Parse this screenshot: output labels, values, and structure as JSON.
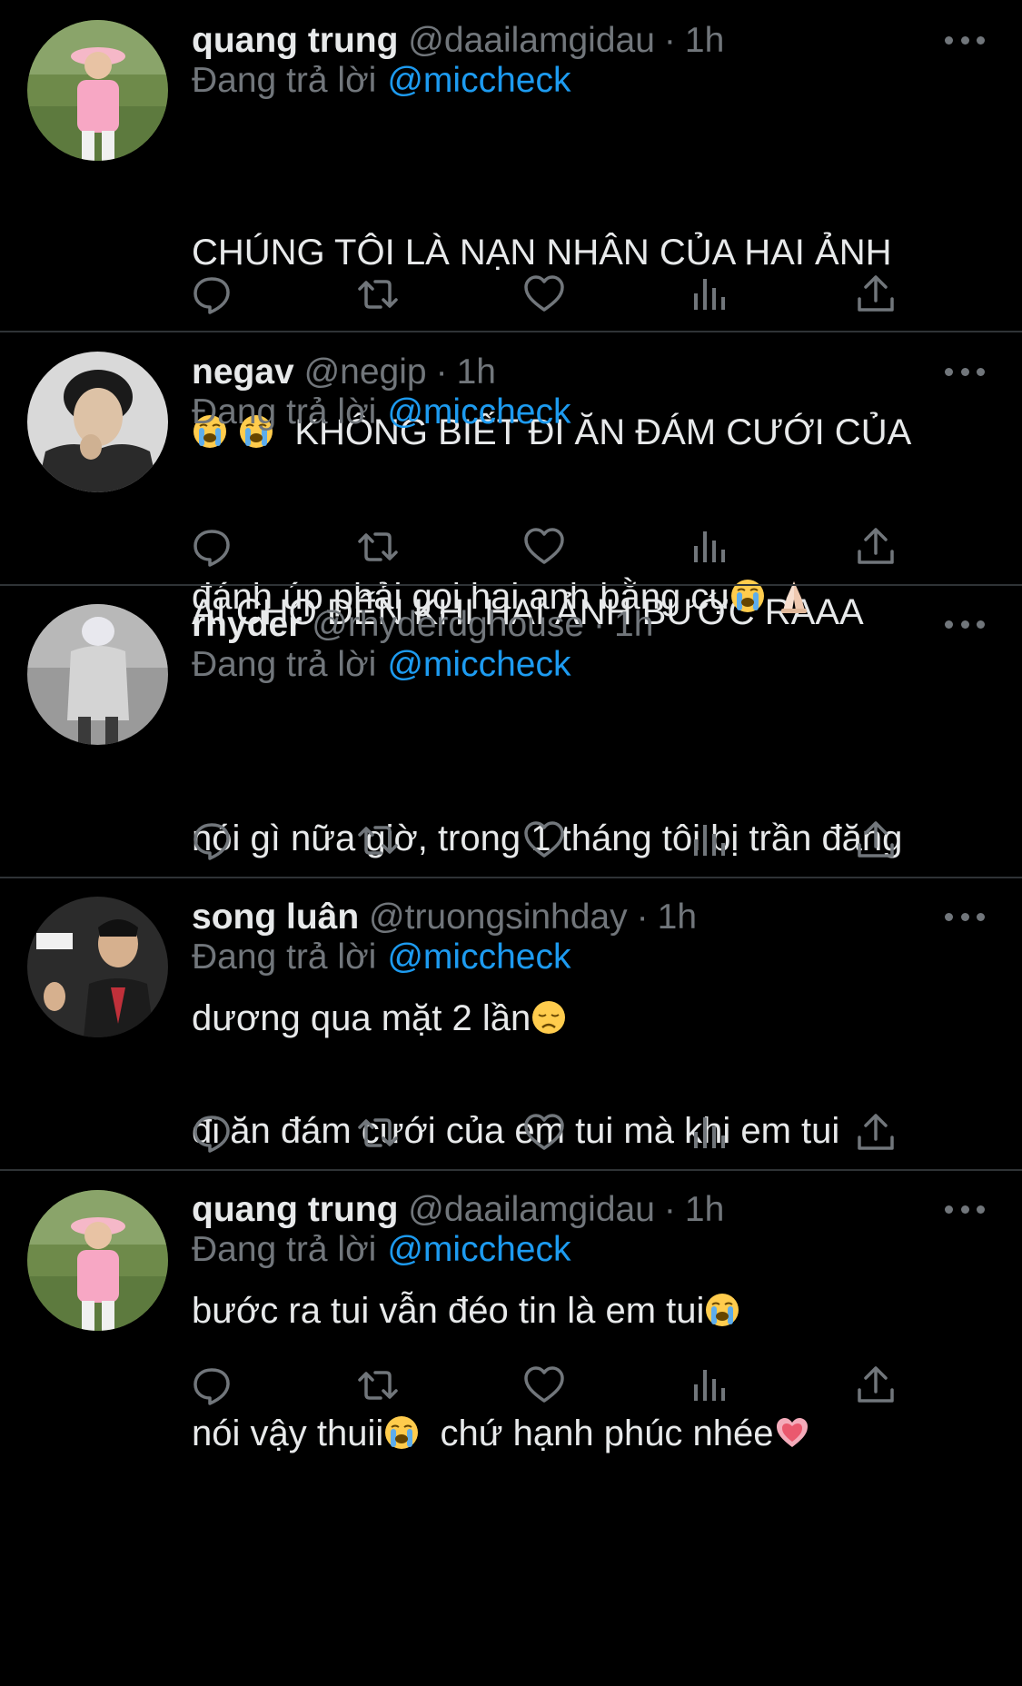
{
  "colors": {
    "background": "#000000",
    "text": "#e7e9ea",
    "muted": "#71767b",
    "mention": "#1d9bf0",
    "divider": "#2f3336"
  },
  "icons": {
    "reply": "reply-icon",
    "retweet": "retweet-icon",
    "like": "heart-icon",
    "views": "views-icon",
    "share": "share-icon",
    "more": "more-options-icon"
  },
  "tweets": [
    {
      "name": "quang trung",
      "handle": "@daailamgidau",
      "dot": "·",
      "time": "1h",
      "reply_prefix": "Đang trả lời",
      "reply_to": "@miccheck",
      "text_lines": [
        "CHÚNG TÔI LÀ NẠN NHÂN CỦA HAI ẢNH",
        "  KHÔNG BIẾT ĐI ĂN ĐÁM CƯỚI CỦA",
        "AI CHO ĐẾN KHI HAI ẢNH BƯỚC RAAA"
      ],
      "emojis": [
        "loudly-crying-face",
        "loudly-crying-face"
      ]
    },
    {
      "name": "negav",
      "handle": "@negip",
      "dot": "·",
      "time": "1h",
      "reply_prefix": "Đang trả lời",
      "reply_to": "@miccheck",
      "text_lines": [
        "đánh úp phải gọi hai anh bằng cụ"
      ],
      "emojis": [
        "loudly-crying-face",
        "folded-hands"
      ]
    },
    {
      "name": "rhyder",
      "handle": "@rhyderdghouse",
      "dot": "·",
      "time": "1h",
      "reply_prefix": "Đang trả lời",
      "reply_to": "@miccheck",
      "text_lines": [
        "nói gì nữa giờ, trong 1 tháng tôi bị trần đăng",
        "dương qua mặt 2 lần"
      ],
      "emojis": [
        "disappointed-face"
      ]
    },
    {
      "name": "song luân",
      "handle": "@truongsinhday",
      "dot": "·",
      "time": "1h",
      "reply_prefix": "Đang trả lời",
      "reply_to": "@miccheck",
      "text_lines": [
        "đi ăn đám cưới của em tui mà khi em tui",
        "bước ra tui vẫn đéo tin là em tui"
      ],
      "emojis": [
        "loudly-crying-face"
      ]
    },
    {
      "name": "quang trung",
      "handle": "@daailamgidau",
      "dot": "·",
      "time": "1h",
      "reply_prefix": "Đang trả lời",
      "reply_to": "@miccheck",
      "text_lines": [
        "nói vậy thuii",
        "  chứ hạnh phúc nhée"
      ],
      "emojis": [
        "loudly-crying-face",
        "growing-heart"
      ]
    }
  ]
}
